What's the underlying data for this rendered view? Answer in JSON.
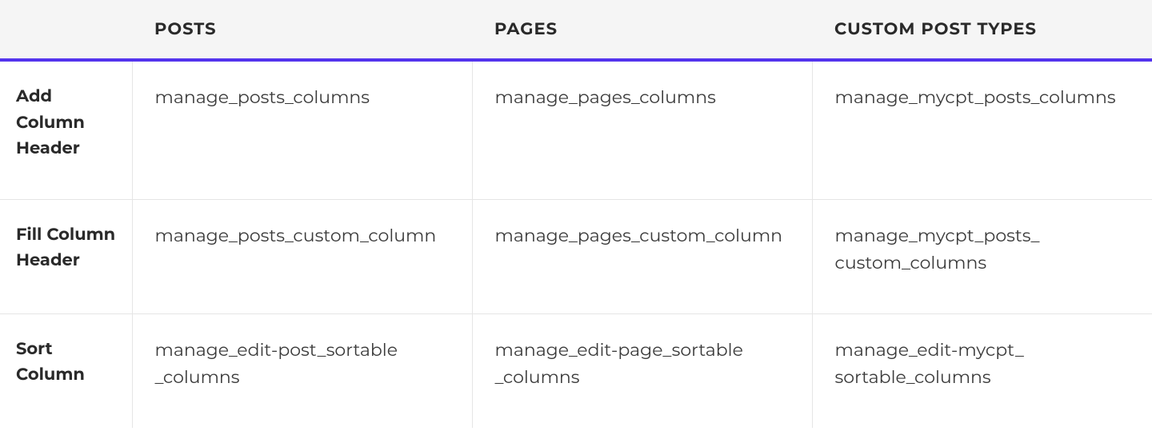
{
  "table": {
    "headers": {
      "blank": "",
      "posts": "POSTS",
      "pages": "PAGES",
      "cpt": "CUSTOM POST TYPES"
    },
    "rows": [
      {
        "label": "Add Column Header",
        "posts": "manage_posts_columns",
        "pages": "manage_pages_columns",
        "cpt": "manage_mycpt_posts_​columns"
      },
      {
        "label": "Fill Column Header",
        "posts": "manage_posts_custom_​column",
        "pages": "manage_pages_custom_​column",
        "cpt": "manage_mycpt_posts_​custom_columns"
      },
      {
        "label": "Sort Column",
        "posts": "manage_edit-post_sortable​_columns",
        "pages": "manage_edit-page_sortable​_columns",
        "cpt": "manage_edit-mycpt_​sortable_columns"
      }
    ]
  }
}
